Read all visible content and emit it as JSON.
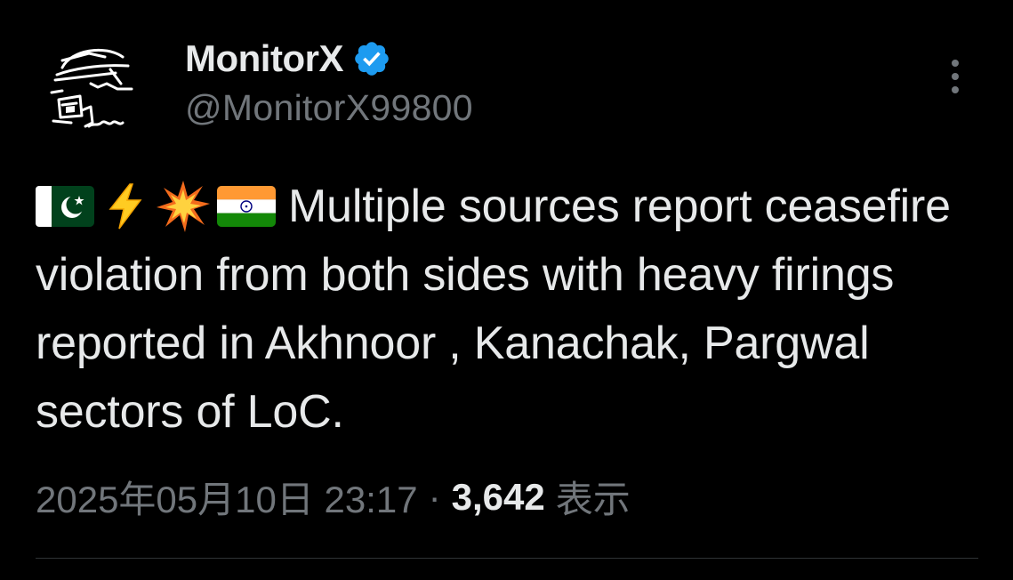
{
  "author": {
    "display_name": "MonitorX",
    "handle": "@MonitorX99800",
    "verified": true,
    "avatar_icon": "hooded-figure-sketch-icon"
  },
  "tweet": {
    "emojis": [
      "pakistan-flag-icon",
      "lightning-icon",
      "collision-icon",
      "india-flag-icon"
    ],
    "text": "Multiple sources report ceasefire violation from both sides with heavy firings reported in Akhnoor , Kanachak, Pargwal sectors of LoC."
  },
  "meta": {
    "timestamp": "2025年05月10日 23:17",
    "separator": "·",
    "views_count": "3,642",
    "views_label": "表示"
  },
  "colors": {
    "background": "#000000",
    "text_primary": "#e7e9ea",
    "text_secondary": "#71767b",
    "verified_blue": "#1d9bf0",
    "divider": "#2f3336"
  }
}
